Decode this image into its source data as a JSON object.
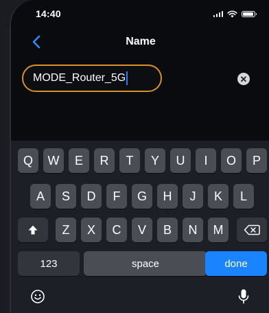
{
  "status_bar": {
    "time": "14:40",
    "icons": [
      "cellular-signal-icon",
      "wifi-icon",
      "battery-icon"
    ]
  },
  "nav": {
    "title": "Name",
    "back_icon": "chevron-left-icon"
  },
  "field": {
    "value": "MODE_Router_5G",
    "clear_icon": "clear-icon"
  },
  "keyboard": {
    "row1": [
      "Q",
      "W",
      "E",
      "R",
      "T",
      "Y",
      "U",
      "I",
      "O",
      "P"
    ],
    "row2": [
      "A",
      "S",
      "D",
      "F",
      "G",
      "H",
      "J",
      "K",
      "L"
    ],
    "row3": [
      "Z",
      "X",
      "C",
      "V",
      "B",
      "N",
      "M"
    ],
    "shift_icon": "shift-icon",
    "backspace_icon": "backspace-icon",
    "numbers_label": "123",
    "space_label": "space",
    "done_label": "done",
    "emoji_icon": "emoji-icon",
    "mic_icon": "microphone-icon"
  },
  "colors": {
    "accent": "#1a84ff",
    "field_border": "#d9912b",
    "caret": "#2f7cf6"
  }
}
